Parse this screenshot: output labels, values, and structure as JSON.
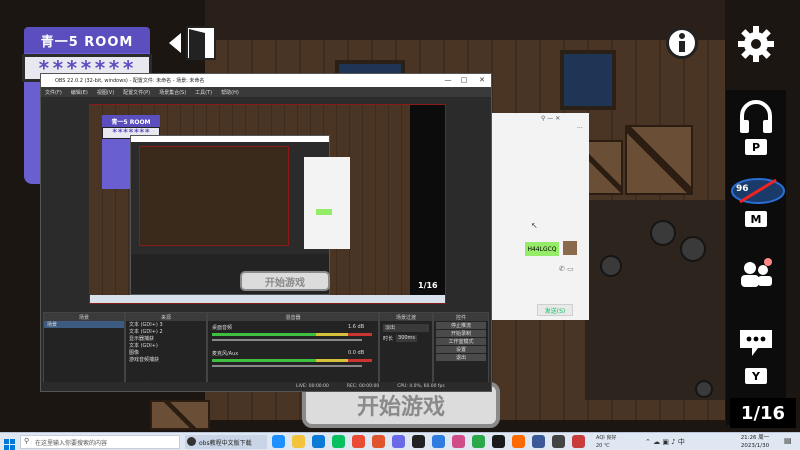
{
  "game": {
    "room_title": "青一5 ROOM",
    "room_password": "*******",
    "start_button": "开始游戏",
    "page_count": "1/16",
    "hotkeys": {
      "headset": "P",
      "mic": "M",
      "voice": "Y"
    },
    "mic_status": "96",
    "icons": [
      "door-icon",
      "info-icon",
      "gear-icon",
      "headphones-icon",
      "mic-muted-icon",
      "friends-icon",
      "chat-icon"
    ]
  },
  "obs": {
    "window_title": "OBS 22.0.2 (32-bit, windows) - 配置文件: 未命名 - 场景: 未命名",
    "menu": [
      "文件(F)",
      "编辑(E)",
      "视图(V)",
      "配置文件(P)",
      "场景集合(S)",
      "工具(T)",
      "帮助(H)"
    ],
    "preview": {
      "room_title": "青一5 ROOM",
      "room_password": "*******",
      "start_button": "开始游戏",
      "page_count": "1/16"
    },
    "docks": {
      "scenes": {
        "header": "场景",
        "items": [
          "场景"
        ]
      },
      "sources": {
        "header": "来源",
        "items": [
          "文本 (GDI+) 3",
          "文本 (GDI+) 2",
          "显示器捕获",
          "文本 (GDI+)",
          "图像",
          "游戏音频捕获"
        ]
      },
      "mixer": {
        "header": "混音器",
        "channels": [
          {
            "name": "桌面音频",
            "level": "1.6 dB"
          },
          {
            "name": "麦克风/Aux",
            "level": "0.0 dB"
          }
        ]
      },
      "transitions": {
        "header": "场景过渡",
        "type": "淡出",
        "duration_label": "时长",
        "duration": "300ms"
      },
      "controls": {
        "header": "控件",
        "buttons": [
          "停止推流",
          "开始录制",
          "工作室模式",
          "设置",
          "退出"
        ]
      }
    },
    "status": {
      "live": "LIVE: 00:00:00",
      "rec": "REC: 00:00:00",
      "cpu": "CPU: 4.0%, 60.00 fps"
    }
  },
  "chat": {
    "message": "H44LGCQ",
    "send_label": "发送(S)"
  },
  "taskbar": {
    "search_placeholder": "在这里输入你要搜索的内容",
    "obs_task": "obs教程中文版下载",
    "tray_text_1": "AQI 良好",
    "tray_text_2": "20 ℃",
    "time": "21:26 周一",
    "date": "2023/1/30"
  },
  "colors": {
    "accent": "#5b4fbf",
    "wechat_green": "#95ec69",
    "obs_red_frame": "#8b1a1a"
  }
}
